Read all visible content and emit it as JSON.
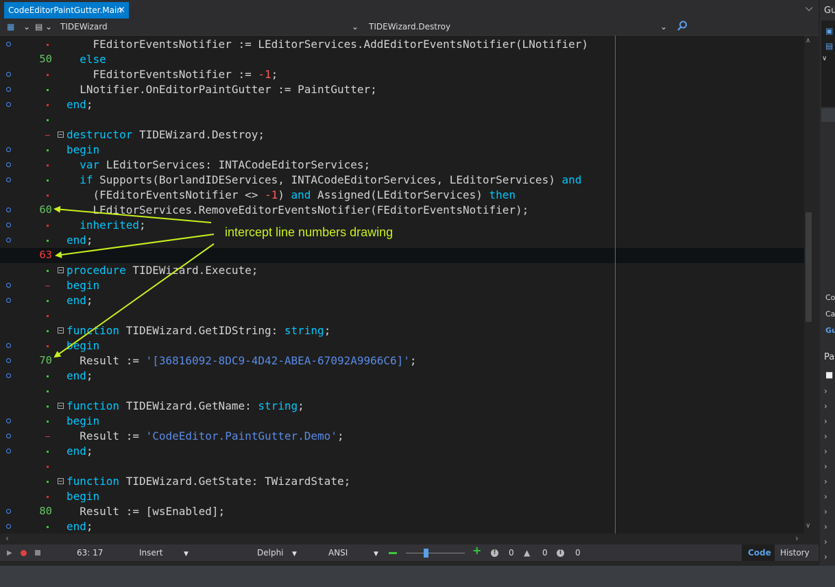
{
  "tab": {
    "title": "CodeEditorPaintGutter.Main",
    "close": "×"
  },
  "navigator": {
    "class_name": "TIDEWizard",
    "method_name": "TIDEWizard.Destroy"
  },
  "lines": [
    {
      "n": "",
      "red": false,
      "bp": true,
      "mk": "r",
      "fold": false,
      "segs": [
        [
          "    FEditorEventsNotifier := LEditorServices.AddEditorEventsNotifier(LNotifier)",
          ""
        ]
      ]
    },
    {
      "n": "50",
      "red": false,
      "bp": false,
      "mk": "",
      "fold": false,
      "segs": [
        [
          "  ",
          ""
        ],
        [
          "else",
          "kw"
        ]
      ]
    },
    {
      "n": "",
      "red": false,
      "bp": true,
      "mk": "r",
      "fold": false,
      "segs": [
        [
          "    FEditorEventsNotifier := ",
          ""
        ],
        [
          "-1",
          "num"
        ],
        [
          ";",
          ""
        ]
      ]
    },
    {
      "n": "",
      "red": false,
      "bp": true,
      "mk": "g",
      "fold": false,
      "segs": [
        [
          "  LNotifier.OnEditorPaintGutter := PaintGutter;",
          ""
        ]
      ]
    },
    {
      "n": "",
      "red": false,
      "bp": true,
      "mk": "r",
      "fold": false,
      "segs": [
        [
          "end",
          "kw"
        ],
        [
          ";",
          ""
        ]
      ]
    },
    {
      "n": "",
      "red": false,
      "bp": false,
      "mk": "g",
      "fold": false,
      "segs": []
    },
    {
      "n": "",
      "red": false,
      "bp": false,
      "mk": "d",
      "fold": true,
      "segs": [
        [
          "destructor",
          "kw"
        ],
        [
          " TIDEWizard.Destroy;",
          ""
        ]
      ]
    },
    {
      "n": "",
      "red": false,
      "bp": true,
      "mk": "g",
      "fold": false,
      "segs": [
        [
          "begin",
          "kw"
        ]
      ]
    },
    {
      "n": "",
      "red": false,
      "bp": true,
      "mk": "r",
      "fold": false,
      "segs": [
        [
          "  ",
          ""
        ],
        [
          "var",
          "kw"
        ],
        [
          " LEditorServices: INTACodeEditorServices;",
          ""
        ]
      ]
    },
    {
      "n": "",
      "red": false,
      "bp": true,
      "mk": "g",
      "fold": false,
      "segs": [
        [
          "  ",
          ""
        ],
        [
          "if",
          "kw"
        ],
        [
          " Supports(BorlandIDEServices, INTACodeEditorServices, LEditorServices) ",
          ""
        ],
        [
          "and",
          "kw"
        ]
      ]
    },
    {
      "n": "",
      "red": false,
      "bp": false,
      "mk": "r",
      "fold": false,
      "segs": [
        [
          "    (FEditorEventsNotifier <> ",
          ""
        ],
        [
          "-1",
          "num"
        ],
        [
          ") ",
          ""
        ],
        [
          "and",
          "kw"
        ],
        [
          " Assigned(LEditorServices) ",
          ""
        ],
        [
          "then",
          "kw"
        ]
      ]
    },
    {
      "n": "60",
      "red": false,
      "bp": true,
      "mk": "",
      "fold": false,
      "segs": [
        [
          "    LEditorServices.RemoveEditorEventsNotifier(FEditorEventsNotifier);",
          ""
        ]
      ]
    },
    {
      "n": "",
      "red": false,
      "bp": true,
      "mk": "r",
      "fold": false,
      "segs": [
        [
          "  ",
          ""
        ],
        [
          "inherited",
          "kw"
        ],
        [
          ";",
          ""
        ]
      ]
    },
    {
      "n": "",
      "red": false,
      "bp": true,
      "mk": "g",
      "fold": false,
      "segs": [
        [
          "end",
          "kw"
        ],
        [
          ";",
          ""
        ]
      ]
    },
    {
      "n": "63",
      "red": true,
      "bp": false,
      "mk": "",
      "fold": false,
      "segs": []
    },
    {
      "n": "",
      "red": false,
      "bp": false,
      "mk": "g",
      "fold": true,
      "segs": [
        [
          "procedure",
          "kw"
        ],
        [
          " TIDEWizard.Execute;",
          ""
        ]
      ]
    },
    {
      "n": "",
      "red": false,
      "bp": true,
      "mk": "d",
      "fold": false,
      "segs": [
        [
          "begin",
          "kw"
        ]
      ]
    },
    {
      "n": "",
      "red": false,
      "bp": true,
      "mk": "g",
      "fold": false,
      "segs": [
        [
          "end",
          "kw"
        ],
        [
          ";",
          ""
        ]
      ]
    },
    {
      "n": "",
      "red": false,
      "bp": false,
      "mk": "r",
      "fold": false,
      "segs": []
    },
    {
      "n": "",
      "red": false,
      "bp": false,
      "mk": "g",
      "fold": true,
      "segs": [
        [
          "function",
          "kw"
        ],
        [
          " TIDEWizard.GetIDString: ",
          ""
        ],
        [
          "string",
          "kw"
        ],
        [
          ";",
          ""
        ]
      ]
    },
    {
      "n": "",
      "red": false,
      "bp": true,
      "mk": "r",
      "fold": false,
      "segs": [
        [
          "begin",
          "kw"
        ]
      ]
    },
    {
      "n": "70",
      "red": false,
      "bp": true,
      "mk": "",
      "fold": false,
      "segs": [
        [
          "  Result := ",
          ""
        ],
        [
          "'[36816092-8DC9-4D42-ABEA-67092A9966C6]'",
          "str"
        ],
        [
          ";",
          ""
        ]
      ]
    },
    {
      "n": "",
      "red": false,
      "bp": true,
      "mk": "g",
      "fold": false,
      "segs": [
        [
          "end",
          "kw"
        ],
        [
          ";",
          ""
        ]
      ]
    },
    {
      "n": "",
      "red": false,
      "bp": false,
      "mk": "g",
      "fold": false,
      "segs": []
    },
    {
      "n": "",
      "red": false,
      "bp": false,
      "mk": "g",
      "fold": true,
      "segs": [
        [
          "function",
          "kw"
        ],
        [
          " TIDEWizard.GetName: ",
          ""
        ],
        [
          "string",
          "kw"
        ],
        [
          ";",
          ""
        ]
      ]
    },
    {
      "n": "",
      "red": false,
      "bp": true,
      "mk": "g",
      "fold": false,
      "segs": [
        [
          "begin",
          "kw"
        ]
      ]
    },
    {
      "n": "",
      "red": false,
      "bp": true,
      "mk": "d",
      "fold": false,
      "segs": [
        [
          "  Result := ",
          ""
        ],
        [
          "'CodeEditor.PaintGutter.Demo'",
          "str"
        ],
        [
          ";",
          ""
        ]
      ]
    },
    {
      "n": "",
      "red": false,
      "bp": true,
      "mk": "g",
      "fold": false,
      "segs": [
        [
          "end",
          "kw"
        ],
        [
          ";",
          ""
        ]
      ]
    },
    {
      "n": "",
      "red": false,
      "bp": false,
      "mk": "r",
      "fold": false,
      "segs": []
    },
    {
      "n": "",
      "red": false,
      "bp": false,
      "mk": "g",
      "fold": true,
      "segs": [
        [
          "function",
          "kw"
        ],
        [
          " TIDEWizard.GetState: TWizardState;",
          ""
        ]
      ]
    },
    {
      "n": "",
      "red": false,
      "bp": false,
      "mk": "r",
      "fold": false,
      "segs": [
        [
          "begin",
          "kw"
        ]
      ]
    },
    {
      "n": "80",
      "red": false,
      "bp": true,
      "mk": "",
      "fold": false,
      "segs": [
        [
          "  Result := [wsEnabled];",
          ""
        ]
      ]
    },
    {
      "n": "",
      "red": false,
      "bp": true,
      "mk": "g",
      "fold": false,
      "segs": [
        [
          "end",
          "kw"
        ],
        [
          ";",
          ""
        ]
      ]
    }
  ],
  "annotation": "intercept line numbers drawing",
  "status": {
    "position": "63: 17",
    "mode": "Insert",
    "language": "Delphi",
    "encoding": "ANSI",
    "errors": "0",
    "warnings": "0",
    "hints": "0",
    "tab_code": "Code",
    "tab_history": "History"
  },
  "right_panel": {
    "top_label": "Gu",
    "co": "Co",
    "ca": "Ca",
    "gu": "Gu",
    "pa": "Pa"
  }
}
